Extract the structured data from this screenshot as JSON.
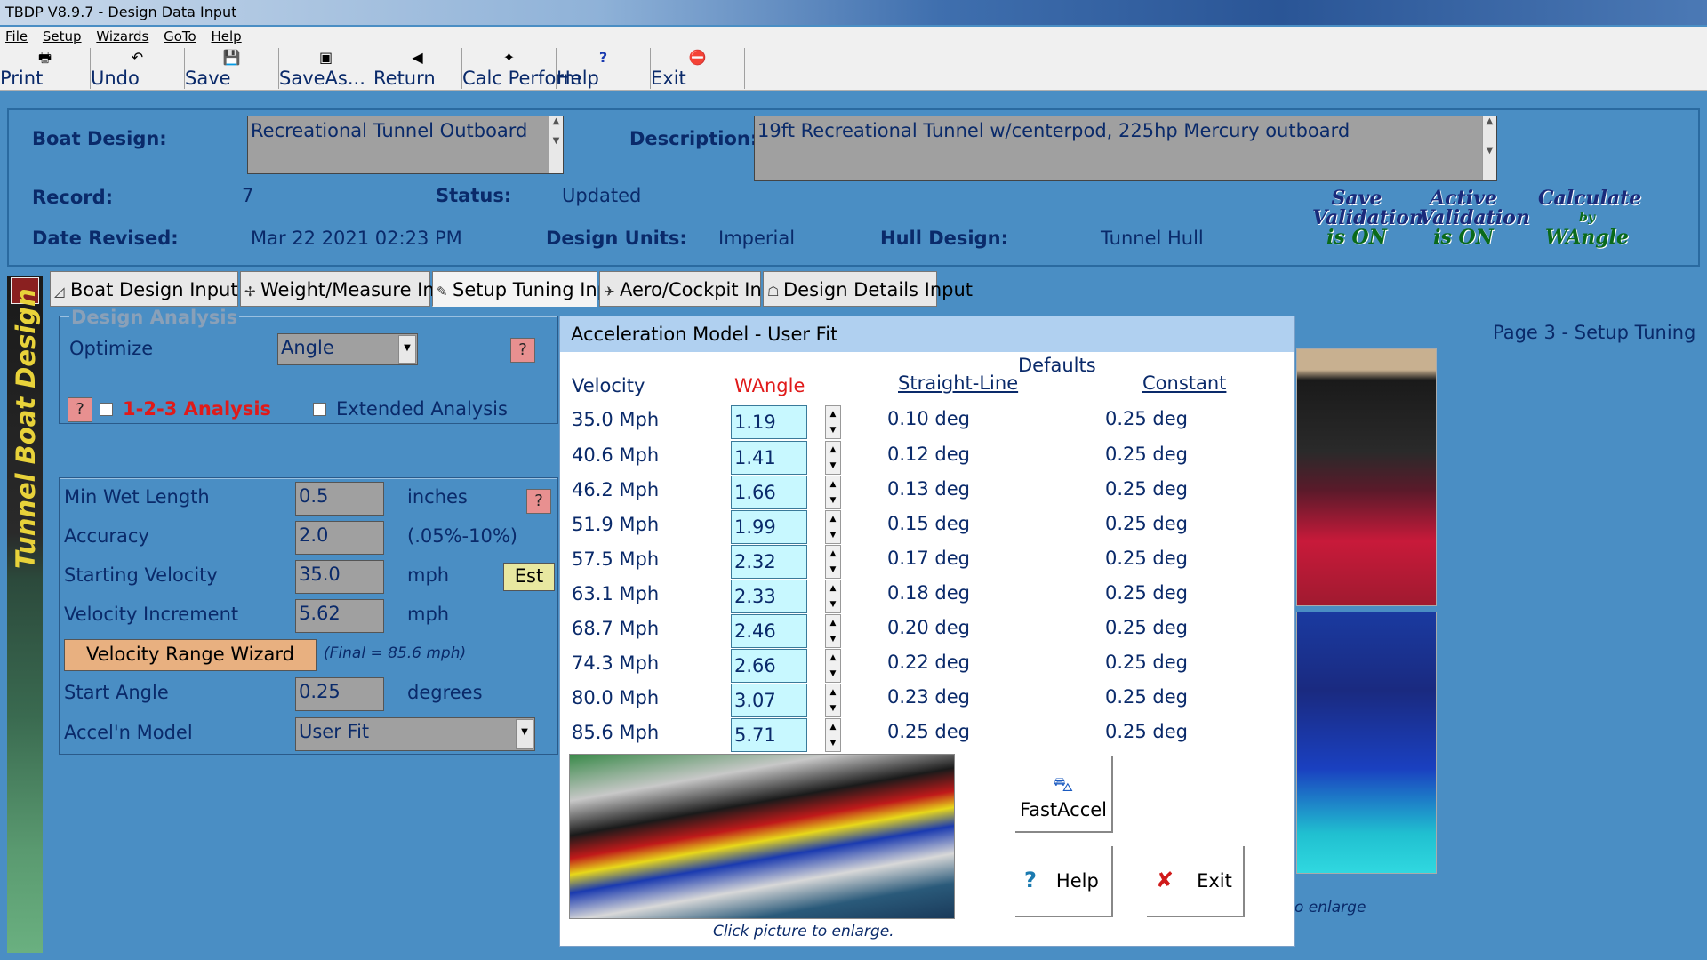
{
  "window": {
    "title": "TBDP V8.9.7 - Design Data Input"
  },
  "menu": [
    "File",
    "Setup",
    "Wizards",
    "GoTo",
    "Help"
  ],
  "toolbar": [
    {
      "label": "Print",
      "icon": "printer-icon",
      "glyph": "🖶"
    },
    {
      "label": "Undo",
      "icon": "undo-icon",
      "glyph": "↶"
    },
    {
      "label": "Save",
      "icon": "floppy-icon",
      "glyph": "💾"
    },
    {
      "label": "SaveAs...",
      "icon": "save-as-icon",
      "glyph": "▣"
    },
    {
      "label": "Return",
      "icon": "return-icon",
      "glyph": "◀"
    },
    {
      "label": "Calc Perform",
      "icon": "calculate-icon",
      "glyph": "✦"
    },
    {
      "label": "Help",
      "icon": "help-icon",
      "glyph": "?"
    },
    {
      "label": "Exit",
      "icon": "stop-icon",
      "glyph": "⛔"
    }
  ],
  "header": {
    "boat_design_label": "Boat Design:",
    "boat_design_value": "Recreational Tunnel Outboard",
    "description_label": "Description:",
    "description_value": "19ft Recreational Tunnel w/centerpod, 225hp Mercury outboard",
    "record_label": "Record:",
    "record_value": "7",
    "status_label": "Status:",
    "status_value": "Updated",
    "date_label": "Date Revised:",
    "date_value": "Mar 22 2021 02:23 PM",
    "units_label": "Design Units:",
    "units_value": "Imperial",
    "hull_label": "Hull Design:",
    "hull_value": "Tunnel Hull",
    "badges": {
      "save_validation": [
        "Save",
        "Validation",
        "is ON"
      ],
      "active_validation": [
        "Active",
        "Validation",
        "is ON"
      ],
      "calculate": [
        "Calculate",
        "by",
        "WAngle"
      ]
    }
  },
  "sidebar": {
    "vertical_title": "Tunnel Boat Design"
  },
  "tabs": [
    {
      "label": "Boat Design Input",
      "glyph": "◿"
    },
    {
      "label": "Weight/Measure Input",
      "glyph": "✢"
    },
    {
      "label": "Setup Tuning Input",
      "glyph": "✎"
    },
    {
      "label": "Aero/Cockpit Input",
      "glyph": "✈"
    },
    {
      "label": "Design Details Input",
      "glyph": "☖"
    }
  ],
  "analysis": {
    "group_title": "Design Analysis",
    "optimize_label": "Optimize",
    "optimize_value": "Angle",
    "help_glyph": "?",
    "analysis_123_label": "1-2-3 Analysis",
    "extended_label": "Extended Analysis"
  },
  "params": {
    "min_wet_length_label": "Min Wet Length",
    "min_wet_length_value": "0.5",
    "min_wet_length_unit": "inches",
    "accuracy_label": "Accuracy",
    "accuracy_value": "2.0",
    "accuracy_unit": "(.05%-10%)",
    "starting_velocity_label": "Starting Velocity",
    "starting_velocity_value": "35.0",
    "starting_velocity_unit": "mph",
    "est_label": "Est",
    "velocity_increment_label": "Velocity Increment",
    "velocity_increment_value": "5.62",
    "velocity_increment_unit": "mph",
    "wizard_label": "Velocity Range Wizard",
    "wizard_note": "(Final = 85.6 mph)",
    "start_angle_label": "Start Angle",
    "start_angle_value": "0.25",
    "start_angle_unit": "degrees",
    "accel_model_label": "Accel'n Model",
    "accel_model_value": "User Fit"
  },
  "page": {
    "title": "Page 3 - Setup Tuning",
    "enlarge_fragment": "o enlarge"
  },
  "dialog": {
    "title": "Acceleration Model - User Fit",
    "velocity_header": "Velocity",
    "wangle_header": "WAngle",
    "defaults_header": "Defaults",
    "straight_header": "Straight-Line",
    "constant_header": "Constant",
    "rows": [
      {
        "velocity": "35.0 Mph",
        "wangle": "1.19",
        "straight": "0.10 deg",
        "constant": "0.25 deg"
      },
      {
        "velocity": "40.6 Mph",
        "wangle": "1.41",
        "straight": "0.12 deg",
        "constant": "0.25 deg"
      },
      {
        "velocity": "46.2 Mph",
        "wangle": "1.66",
        "straight": "0.13 deg",
        "constant": "0.25 deg"
      },
      {
        "velocity": "51.9 Mph",
        "wangle": "1.99",
        "straight": "0.15 deg",
        "constant": "0.25 deg"
      },
      {
        "velocity": "57.5 Mph",
        "wangle": "2.32",
        "straight": "0.17 deg",
        "constant": "0.25 deg"
      },
      {
        "velocity": "63.1 Mph",
        "wangle": "2.33",
        "straight": "0.18 deg",
        "constant": "0.25 deg"
      },
      {
        "velocity": "68.7 Mph",
        "wangle": "2.46",
        "straight": "0.20 deg",
        "constant": "0.25 deg"
      },
      {
        "velocity": "74.3 Mph",
        "wangle": "2.66",
        "straight": "0.22 deg",
        "constant": "0.25 deg"
      },
      {
        "velocity": "80.0 Mph",
        "wangle": "3.07",
        "straight": "0.23 deg",
        "constant": "0.25 deg"
      },
      {
        "velocity": "85.6 Mph",
        "wangle": "5.71",
        "straight": "0.25 deg",
        "constant": "0.25 deg"
      }
    ],
    "caption": "Click picture to enlarge.",
    "fastaccel_label": "FastAccel",
    "help_label": "Help",
    "exit_label": "Exit"
  },
  "colors": {
    "background": "#4a8ec4",
    "text": "#0a2a6a",
    "accent_red": "#e01a1a",
    "input_cyan": "#c8f8ff"
  }
}
